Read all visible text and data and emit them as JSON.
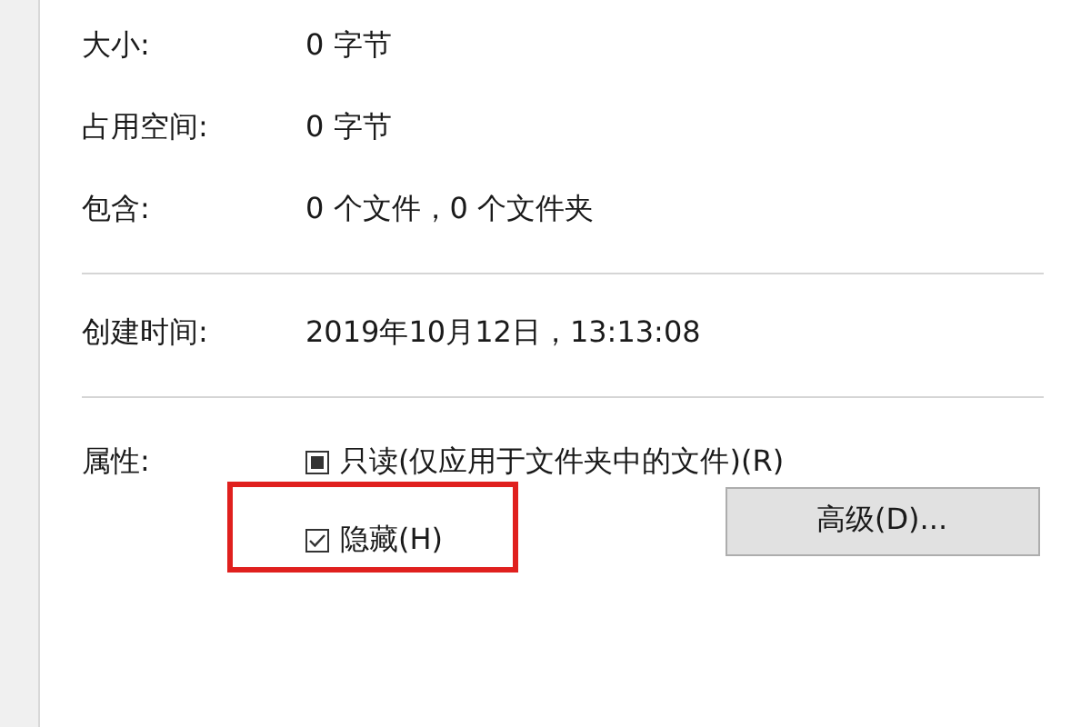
{
  "info_groups": [
    [
      {
        "label": "大小:",
        "value": "0 字节"
      },
      {
        "label": "占用空间:",
        "value": "0 字节"
      },
      {
        "label": "包含:",
        "value": "0 个文件，0 个文件夹"
      }
    ],
    [
      {
        "label": "创建时间:",
        "value": "2019年10月12日，13:13:08"
      }
    ]
  ],
  "attributes": {
    "label": "属性:",
    "items": [
      {
        "label": "只读(仅应用于文件夹中的文件)(R)",
        "checked": true,
        "mixed": true,
        "highlighted": false
      },
      {
        "label": "隐藏(H)",
        "checked": true,
        "mixed": false,
        "highlighted": true
      }
    ],
    "advanced_button": "高级(D)..."
  }
}
